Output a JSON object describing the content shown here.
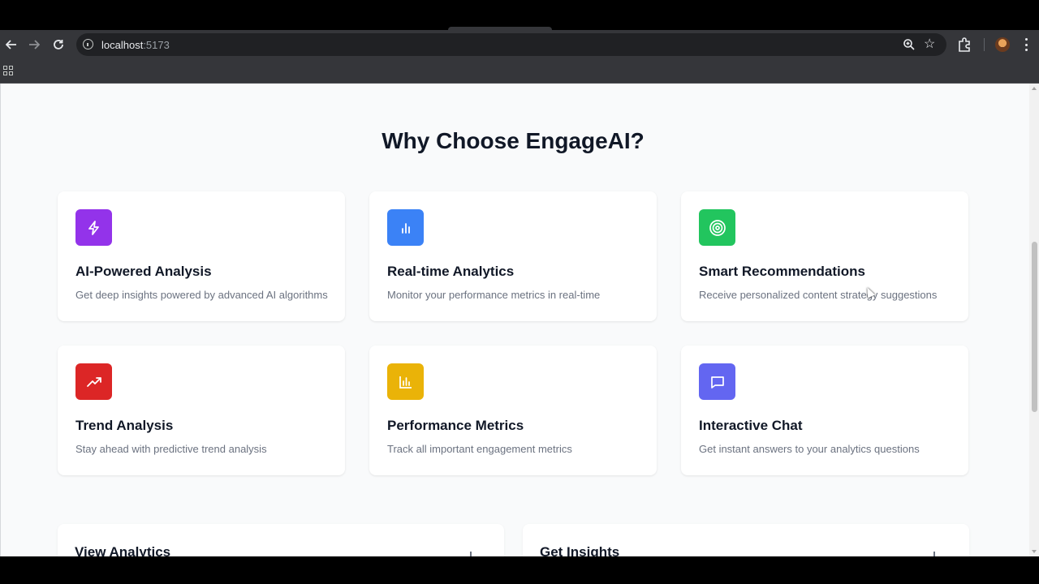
{
  "browser": {
    "url_host": "localhost",
    "url_port": ":5173",
    "icons": [
      "back-arrow-icon",
      "forward-arrow-icon",
      "reload-icon",
      "site-info-icon",
      "zoom-icon",
      "bookmark-star-icon",
      "extensions-puzzle-icon",
      "profile-avatar",
      "more-menu-icon",
      "apps-grid-icon"
    ]
  },
  "page": {
    "section_title": "Why Choose EngageAI?",
    "features": [
      {
        "title": "AI-Powered Analysis",
        "description": "Get deep insights powered by advanced AI algorithms",
        "icon": "lightning-bolt-icon",
        "color": "#9333ea"
      },
      {
        "title": "Real-time Analytics",
        "description": "Monitor your performance metrics in real-time",
        "icon": "bar-chart-icon",
        "color": "#3b82f6"
      },
      {
        "title": "Smart Recommendations",
        "description": "Receive personalized content strategy suggestions",
        "icon": "target-icon",
        "color": "#22c55e"
      },
      {
        "title": "Trend Analysis",
        "description": "Stay ahead with predictive trend analysis",
        "icon": "trending-up-icon",
        "color": "#dc2626"
      },
      {
        "title": "Performance Metrics",
        "description": "Track all important engagement metrics",
        "icon": "bar-chart-box-icon",
        "color": "#eab308"
      },
      {
        "title": "Interactive Chat",
        "description": "Get instant answers to your analytics questions",
        "icon": "chat-bubble-icon",
        "color": "#6366f1"
      }
    ],
    "actions": [
      {
        "title": "View Analytics"
      },
      {
        "title": "Get Insights"
      }
    ]
  }
}
